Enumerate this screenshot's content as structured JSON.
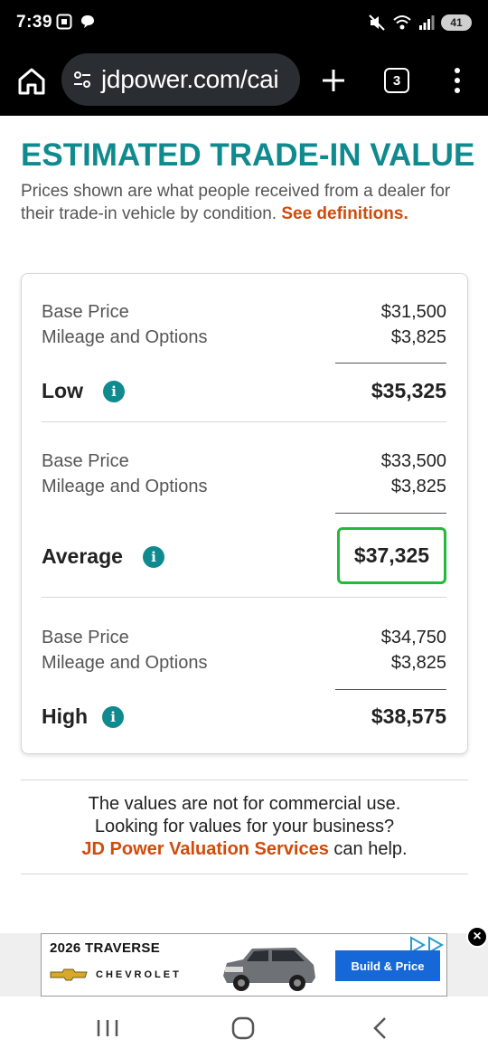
{
  "status_bar": {
    "time": "7:39",
    "battery": "41",
    "icons": [
      "screenshot-icon",
      "chat-bubble-icon",
      "mute-icon",
      "wifi-icon",
      "signal-icon",
      "battery-icon"
    ]
  },
  "browser": {
    "url": "jdpower.com/cai",
    "tab_count": "3",
    "icons": [
      "home-icon",
      "site-settings-icon",
      "plus-icon",
      "tabs-icon",
      "more-vert-icon"
    ]
  },
  "page": {
    "title": "ESTIMATED TRADE-IN VALUE",
    "subtitle": "Prices shown are what people received from a dealer for their trade-in vehicle by condition.",
    "definitions_link": "See definitions."
  },
  "values": {
    "low": {
      "base_label": "Base Price",
      "base_value": "$31,500",
      "mileage_label": "Mileage and Options",
      "mileage_value": "$3,825",
      "total_label": "Low",
      "total_value": "$35,325"
    },
    "average": {
      "base_label": "Base Price",
      "base_value": "$33,500",
      "mileage_label": "Mileage and Options",
      "mileage_value": "$3,825",
      "total_label": "Average",
      "total_value": "$37,325"
    },
    "high": {
      "base_label": "Base Price",
      "base_value": "$34,750",
      "mileage_label": "Mileage and Options",
      "mileage_value": "$3,825",
      "total_label": "High",
      "total_value": "$38,575"
    }
  },
  "notice": {
    "line1": "The values are not for commercial use.",
    "line2": "Looking for values for your business?",
    "link": "JD Power Valuation Services",
    "suffix": " can help."
  },
  "ad": {
    "model": "2026 TRAVERSE",
    "brand": "CHEVROLET",
    "cta": "Build & Price",
    "close": "×"
  },
  "colors": {
    "accent_teal": "#0f8a8f",
    "link_orange": "#d14b0b",
    "highlight_green": "#1fbb3b",
    "ad_button_blue": "#1668d8"
  }
}
